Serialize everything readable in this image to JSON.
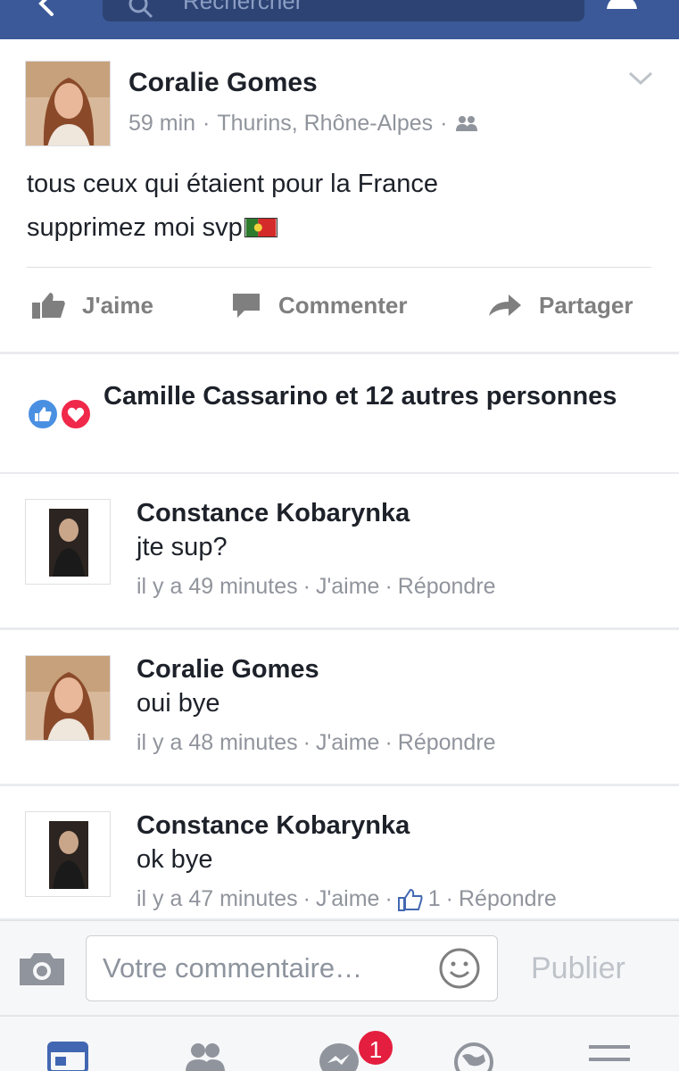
{
  "topbar": {
    "search_placeholder": "Rechercher",
    "icons": [
      "back-icon",
      "search-icon",
      "person-icon"
    ]
  },
  "post": {
    "author": "Coralie Gomes",
    "time": "59 min",
    "location": "Thurins, Rhône-Alpes",
    "privacy_icon": "friends-icon",
    "text_line1": "tous ceux qui étaient pour la France",
    "text_line2": "supprimez moi svp",
    "flag_icon": "portugal-flag-icon",
    "actions": {
      "like": "J'aime",
      "comment": "Commenter",
      "share": "Partager"
    }
  },
  "reactions": {
    "text": "Camille Cassarino et 12 autres personnes",
    "icons": [
      "like-reaction-icon",
      "love-reaction-icon"
    ],
    "colors": {
      "like": "#4a90e2",
      "love": "#f0284a"
    }
  },
  "comments": [
    {
      "author": "Constance Kobarynka",
      "text": "jte sup?",
      "time": "il y a 49 minutes",
      "like": "J'aime",
      "reply": "Répondre",
      "like_count": ""
    },
    {
      "author": "Coralie Gomes",
      "text": "oui bye",
      "time": "il y a 48 minutes",
      "like": "J'aime",
      "reply": "Répondre",
      "like_count": ""
    },
    {
      "author": "Constance Kobarynka",
      "text": "ok bye",
      "time": "il y a 47 minutes",
      "like": "J'aime",
      "reply": "Répondre",
      "like_count": "1"
    }
  ],
  "compose": {
    "placeholder": "Votre commentaire…",
    "publish": "Publier"
  },
  "tabbar": {
    "messenger_badge": "1",
    "tabs": [
      "news-feed-icon",
      "friends-tab-icon",
      "messenger-icon",
      "globe-icon",
      "menu-icon"
    ]
  },
  "colors": {
    "brand": "#3b5998",
    "active_tab": "#4267b2",
    "badge": "#e41e3f"
  }
}
